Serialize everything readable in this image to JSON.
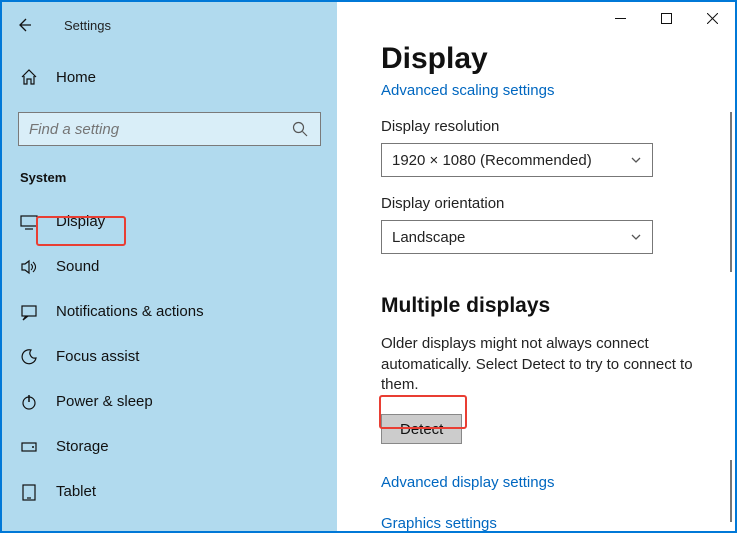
{
  "app_title": "Settings",
  "window_controls": {
    "min": "minimize-icon",
    "max": "maximize-icon",
    "close": "close-icon"
  },
  "home_label": "Home",
  "search_placeholder": "Find a setting",
  "category": "System",
  "nav": {
    "items": [
      {
        "icon": "display-icon",
        "label": "Display"
      },
      {
        "icon": "sound-icon",
        "label": "Sound"
      },
      {
        "icon": "notifications-icon",
        "label": "Notifications & actions"
      },
      {
        "icon": "focus-icon",
        "label": "Focus assist"
      },
      {
        "icon": "power-icon",
        "label": "Power & sleep"
      },
      {
        "icon": "storage-icon",
        "label": "Storage"
      },
      {
        "icon": "tablet-icon",
        "label": "Tablet"
      }
    ]
  },
  "main": {
    "title": "Display",
    "adv_scaling": "Advanced scaling settings",
    "resolution_label": "Display resolution",
    "resolution_value": "1920 × 1080 (Recommended)",
    "orientation_label": "Display orientation",
    "orientation_value": "Landscape",
    "multi_title": "Multiple displays",
    "multi_body": "Older displays might not always connect automatically. Select Detect to try to connect to them.",
    "detect_label": "Detect",
    "adv_display": "Advanced display settings",
    "graphics": "Graphics settings"
  }
}
